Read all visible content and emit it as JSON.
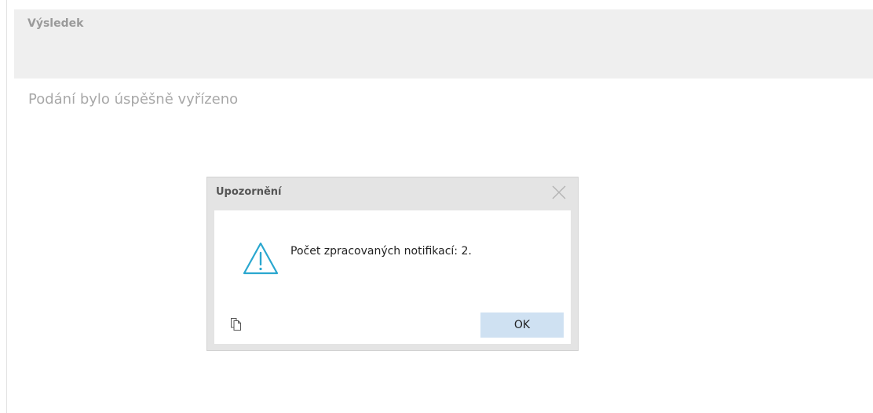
{
  "result": {
    "header_label": "Výsledek",
    "status_text": "Podání bylo úspěšně vyřízeno"
  },
  "dialog": {
    "title": "Upozornění",
    "message": "Počet zpracovaných notifikací: 2.",
    "ok_label": "OK",
    "icon": "warning-icon",
    "close_icon": "close-icon",
    "copy_icon": "copy-icon"
  },
  "colors": {
    "warning_icon": "#2aa7cf",
    "ok_button_bg": "#cfe1f2",
    "header_bg": "#efefef",
    "dialog_frame": "#e4e4e4"
  }
}
